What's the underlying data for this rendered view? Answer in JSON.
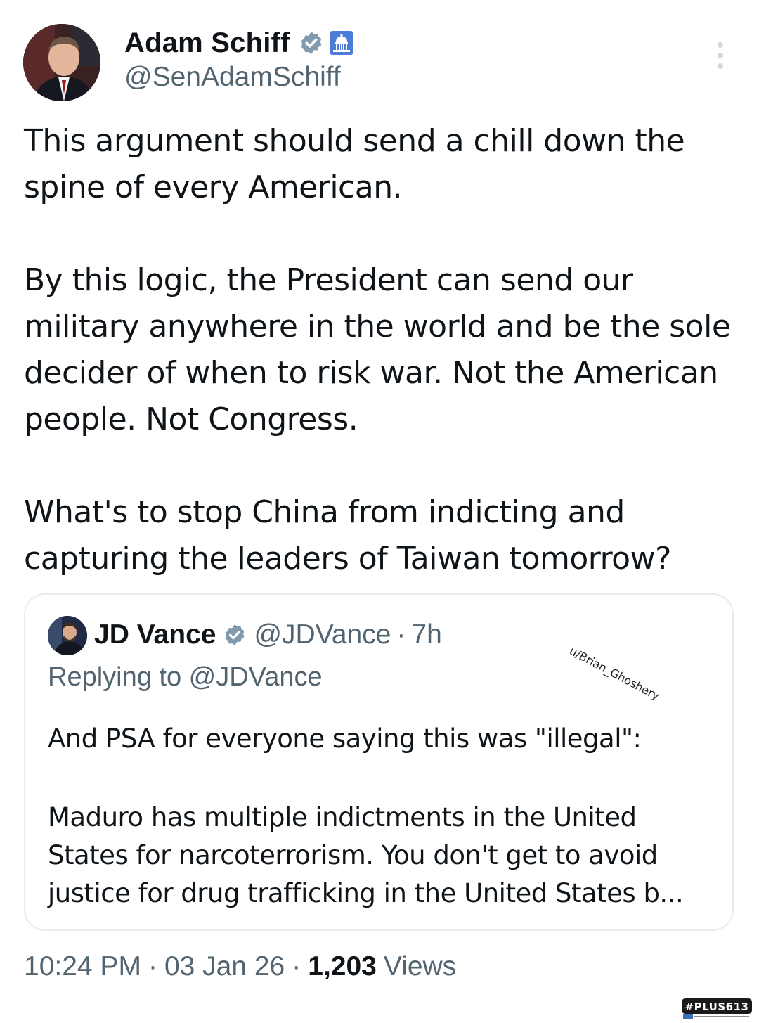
{
  "author": {
    "display_name": "Adam Schiff",
    "handle": "@SenAdamSchiff",
    "badges": [
      "verified-icon",
      "government-capitol-icon"
    ]
  },
  "tweet": {
    "paragraphs": [
      "This argument should send a chill down the spine of every American.",
      "By this logic, the President can send our military anywhere in the world and be the sole decider of when to risk war. Not the American people. Not Congress.",
      "What's to stop China from indicting and capturing the leaders of Taiwan tomorrow?"
    ]
  },
  "quoted": {
    "display_name": "JD Vance",
    "handle": "@JDVance",
    "separator": "·",
    "time": "7h",
    "replying_to": "Replying to @JDVance",
    "paragraphs": [
      "And PSA for everyone saying this was \"illegal\":",
      "Maduro has multiple indictments in the United States for narcoterrorism. You don't get to avoid justice for drug trafficking in the United States b..."
    ],
    "watermark": "u/Brian_Ghoshery"
  },
  "meta": {
    "time": "10:24 PM",
    "dot1": "·",
    "date": "03 Jan 26",
    "dot2": "·",
    "views_count": "1,203",
    "views_label": "Views"
  },
  "corner_logo": {
    "text": "#PLUS613"
  },
  "colors": {
    "text_primary": "#0f1419",
    "text_secondary": "#536471",
    "verified_badge": "#829aab",
    "card_border": "#e6ecf0"
  }
}
